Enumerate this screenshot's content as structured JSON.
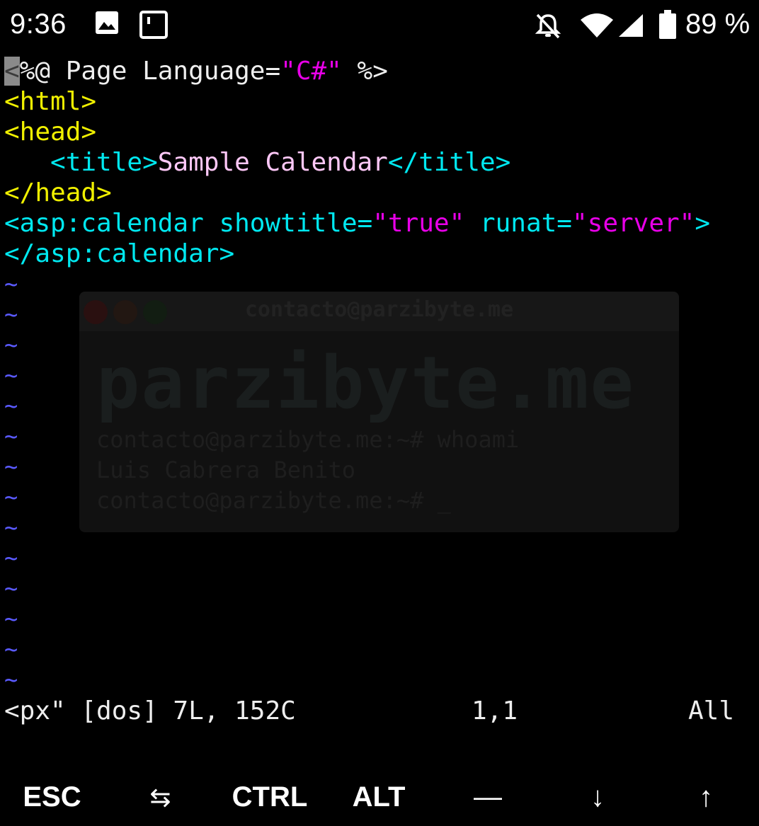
{
  "status_bar": {
    "time": "9:36",
    "battery_percent": "89 %",
    "icons": [
      "image-icon",
      "notification-square-icon",
      "muted-bell-icon",
      "wifi-icon",
      "cell-signal-icon",
      "battery-icon"
    ]
  },
  "editor": {
    "lines": [
      {
        "t1": "<",
        "t2": "%@ Page Language=",
        "t3": "\"C#\"",
        "t4": " %>"
      },
      {
        "t1": "<html>"
      },
      {
        "t1": "<head>"
      },
      {
        "t1": "   <title>",
        "t2": "Sample Calendar",
        "t3": "</title>"
      },
      {
        "t1": "</head>"
      },
      {
        "t1": "<asp",
        "t2": ":calendar",
        "t3": " showtitle=",
        "t4": "\"true\"",
        "t5": " runat=",
        "t6": "\"server\"",
        "t7": ">"
      },
      {
        "t1": "</asp",
        "t2": ":calendar>"
      }
    ],
    "tilde": "~",
    "tilde_count": 14
  },
  "watermark": {
    "title": "contacto@parzibyte.me",
    "big_text": "parzibyte.me",
    "line1": "contacto@parzibyte.me:~# whoami",
    "line2": "Luis Cabrera Benito",
    "line3": "contacto@parzibyte.me:~# _"
  },
  "vim_status": {
    "file_info": "<px\" [dos] 7L, 152C",
    "position": "1,1",
    "scroll": "All"
  },
  "extra_keys": [
    "ESC",
    "⇆",
    "CTRL",
    "ALT",
    "—",
    "↓",
    "↑"
  ],
  "colors": {
    "background": "#000000",
    "tag": "#00e8f0",
    "directive": "#f0f000",
    "string": "#e800e8",
    "text": "#ffc8f8",
    "tilde": "#5a5aff"
  }
}
